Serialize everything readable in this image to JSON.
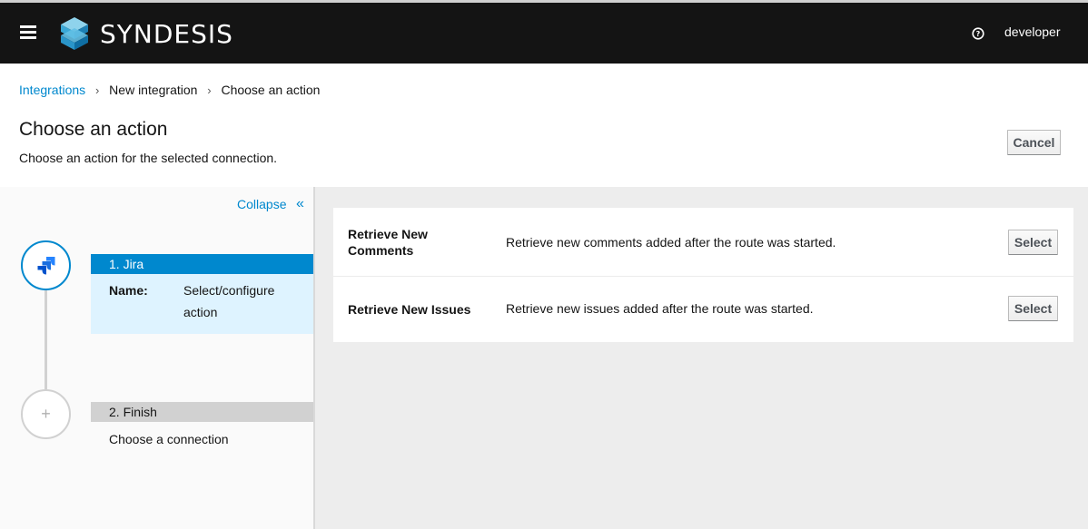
{
  "masthead": {
    "brand": "SYNDESIS",
    "user": "developer",
    "icons": {
      "menu": "hamburger-icon",
      "logo": "syndesis-logo-icon",
      "help": "question-circle-icon"
    }
  },
  "breadcrumb": {
    "items": [
      "Integrations",
      "New integration",
      "Choose an action"
    ],
    "separator": "›"
  },
  "header": {
    "title": "Choose an action",
    "subtitle": "Choose an action for the selected connection.",
    "cancel_label": "Cancel"
  },
  "sidebar": {
    "collapse_label": "Collapse",
    "collapse_icon": "«",
    "steps": [
      {
        "title": "1. Jira",
        "name_label": "Name:",
        "name_value": "Select/configure action",
        "icon": "jira-icon"
      },
      {
        "title": "2. Finish",
        "description": "Choose a connection",
        "icon": "+"
      }
    ]
  },
  "actions": [
    {
      "name": "Retrieve New Comments",
      "description": "Retrieve new comments added after the route was started.",
      "button": "Select"
    },
    {
      "name": "Retrieve New Issues",
      "description": "Retrieve new issues added after the route was started.",
      "button": "Select"
    }
  ],
  "colors": {
    "masthead_bg": "#141414",
    "accent": "#0088ce",
    "active_step_bg": "#def3ff",
    "inactive_step_header": "#d1d1d1",
    "content_bg": "#ededed"
  }
}
